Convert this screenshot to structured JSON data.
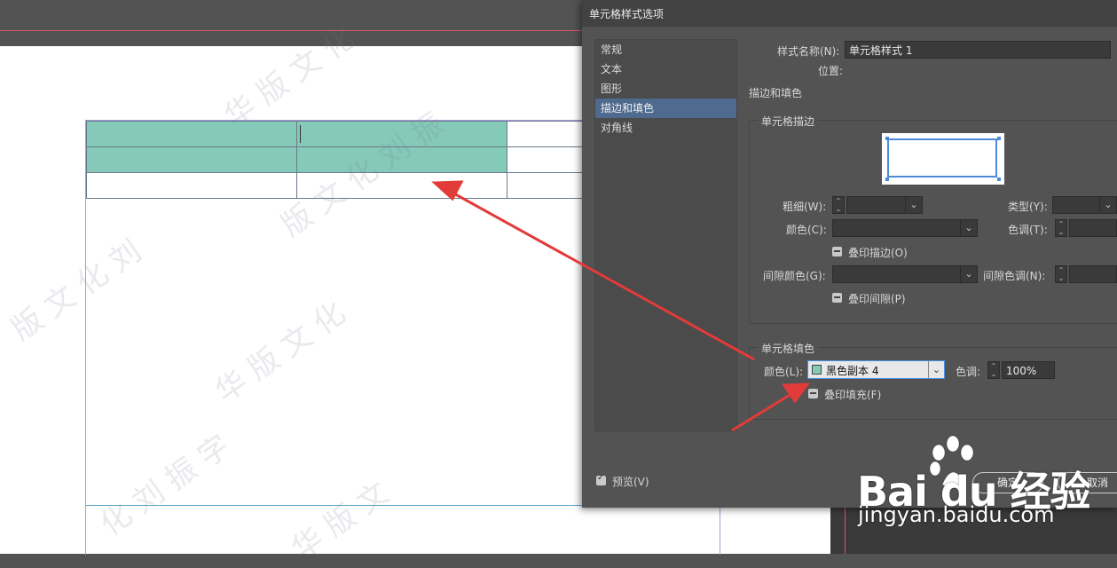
{
  "dialog": {
    "title": "单元格样式选项",
    "categories": [
      {
        "label": "常规"
      },
      {
        "label": "文本"
      },
      {
        "label": "图形"
      },
      {
        "label": "描边和填色",
        "selected": true
      },
      {
        "label": "对角线"
      }
    ],
    "style_name_label": "样式名称(N):",
    "style_name_value": "单元格样式 1",
    "location_label": "位置:",
    "section_heading": "描边和填色",
    "stroke_group": {
      "title": "单元格描边",
      "weight_label": "粗细(W):",
      "type_label": "类型(Y):",
      "color_label": "颜色(C):",
      "tint_label": "色调(T):",
      "overprint_stroke_label": "叠印描边(O)",
      "gap_color_label": "间隙颜色(G):",
      "gap_tint_label": "间隙色调(N):",
      "overprint_gap_label": "叠印间隙(P)"
    },
    "fill_group": {
      "title": "单元格填色",
      "color_label": "颜色(L):",
      "color_value": "黑色副本 4",
      "swatch_color": "#85c9b8",
      "tint_label": "色调:",
      "tint_value": "100%",
      "overprint_fill_label": "叠印填充(F)"
    },
    "preview_label": "预览(V)",
    "ok_label": "确定",
    "cancel_label": "取消"
  },
  "document": {
    "table_fill_color": "#85c9b8"
  },
  "watermark": {
    "logo_text": "Bai  du 经验",
    "url": "jingyan.baidu.com"
  },
  "colors": {
    "accent": "#e33a3a",
    "selection": "#4e6a8e"
  }
}
